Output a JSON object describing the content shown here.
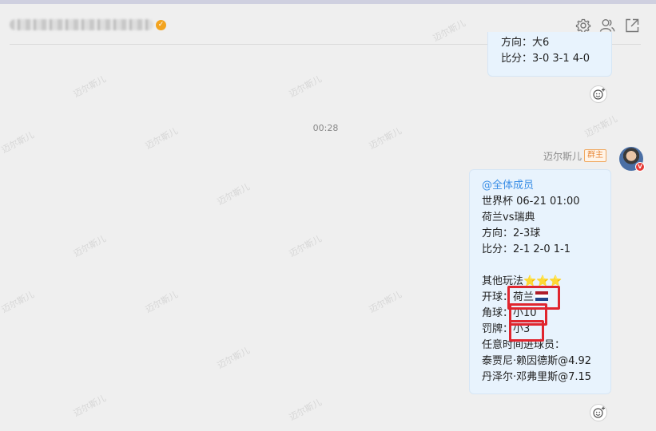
{
  "chat": {
    "prev_message": {
      "line1": "方向：大6",
      "line2": "比分：3-0 3-1 4-0"
    },
    "timestamp": "00:28",
    "sender": {
      "name": "迈尔斯儿",
      "role": "群主"
    },
    "message": {
      "mention": "@全体成员",
      "match_time": "世界杯 06-21 01:00",
      "teams": "荷兰vs瑞典",
      "direction": "方向：2-3球",
      "score": "比分：2-1 2-0 1-1",
      "other_label": "其他玩法",
      "stars": "⭐⭐⭐",
      "kickoff_label": "开球：",
      "kickoff_value": "荷兰",
      "corners_label": "角球：",
      "corners_value": "小10",
      "cards_label": "罚牌：",
      "cards_value": "小3",
      "scorer_label": "任意时间进球员：",
      "scorer1": "泰贾尼·赖因德斯@4.92",
      "scorer2": "丹泽尔·邓弗里斯@7.15"
    }
  },
  "icons": {
    "header": [
      "gear-icon",
      "people-icon",
      "external-link-icon"
    ],
    "reaction": "emoji-add-icon",
    "verified": "verified-badge-icon"
  },
  "colors": {
    "background": "#efefef",
    "bubble": "#e8f3fd",
    "mention": "#3a8ee6",
    "highlight": "#e0252e",
    "role_badge": "#e8893a"
  }
}
